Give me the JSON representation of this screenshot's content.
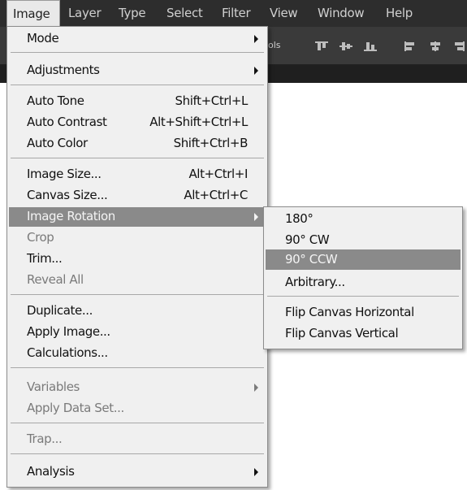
{
  "menubar": {
    "items": [
      "Image",
      "Layer",
      "Type",
      "Select",
      "Filter",
      "View",
      "Window",
      "Help"
    ]
  },
  "options_bar": {
    "partial_label": "ols"
  },
  "image_menu": {
    "mode": "Mode",
    "adjustments": "Adjustments",
    "auto_tone": {
      "label": "Auto Tone",
      "shortcut": "Shift+Ctrl+L"
    },
    "auto_contrast": {
      "label": "Auto Contrast",
      "shortcut": "Alt+Shift+Ctrl+L"
    },
    "auto_color": {
      "label": "Auto Color",
      "shortcut": "Shift+Ctrl+B"
    },
    "image_size": {
      "label": "Image Size...",
      "shortcut": "Alt+Ctrl+I"
    },
    "canvas_size": {
      "label": "Canvas Size...",
      "shortcut": "Alt+Ctrl+C"
    },
    "image_rotation": "Image Rotation",
    "crop": "Crop",
    "trim": "Trim...",
    "reveal_all": "Reveal All",
    "duplicate": "Duplicate...",
    "apply_image": "Apply Image...",
    "calculations": "Calculations...",
    "variables": "Variables",
    "apply_data_set": "Apply Data Set...",
    "trap": "Trap...",
    "analysis": "Analysis"
  },
  "rotation_submenu": {
    "r180": "180°",
    "cw90": "90° CW",
    "ccw90": "90° CCW",
    "arbitrary": "Arbitrary...",
    "flip_h": "Flip Canvas Horizontal",
    "flip_v": "Flip Canvas Vertical"
  },
  "colors": {
    "menubar_bg": "#2d2d2d",
    "menu_bg": "#f0f0f0",
    "highlight_bg": "#8a8a8a",
    "disabled_text": "#7a7a7a"
  }
}
